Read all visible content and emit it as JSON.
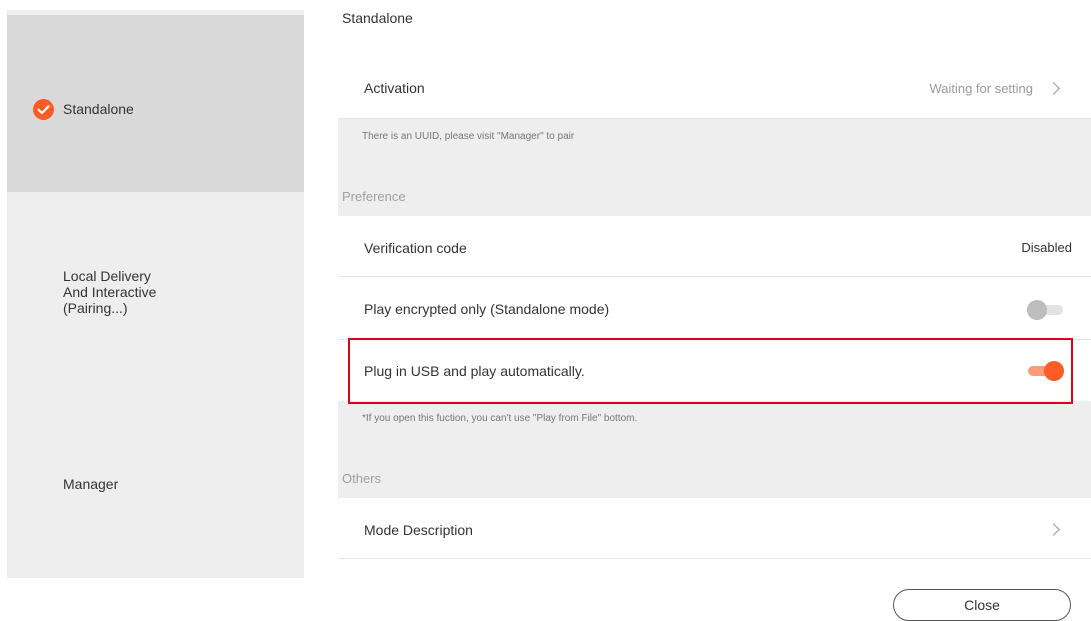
{
  "sidebar": {
    "items": [
      {
        "label": "Standalone",
        "active": true,
        "icon": "check-circle-icon"
      },
      {
        "label": "Local Delivery\nAnd Interactive\n(Pairing...)",
        "active": false
      },
      {
        "label": "Manager",
        "active": false
      }
    ]
  },
  "main": {
    "section_title": "Standalone",
    "activation": {
      "label": "Activation",
      "value": "Waiting for setting",
      "icon": "chevron-right-icon"
    },
    "activation_hint": "There is an UUID, please visit \"Manager\" to pair",
    "preference": {
      "group_label": "Preference",
      "verification": {
        "label": "Verification code",
        "value": "Disabled"
      },
      "play_encrypted": {
        "label": "Play encrypted only (Standalone mode)",
        "enabled": false
      },
      "usb_autoplay": {
        "label": "Plug in USB and play automatically.",
        "enabled": true
      }
    },
    "usb_hint": "*If you open this fuction, you can't use \"Play from File\" bottom.",
    "others": {
      "group_label": "Others",
      "mode_description": {
        "label": "Mode Description",
        "icon": "chevron-right-icon"
      }
    }
  },
  "footer": {
    "close_label": "Close"
  },
  "colors": {
    "accent": "#ff5b24",
    "accent_light": "#ff9a78",
    "highlight_border": "#e0001a",
    "sidebar_bg": "#eeeeee",
    "sidebar_active_bg": "#d9d9d9",
    "muted_text": "#9a9a9a"
  }
}
